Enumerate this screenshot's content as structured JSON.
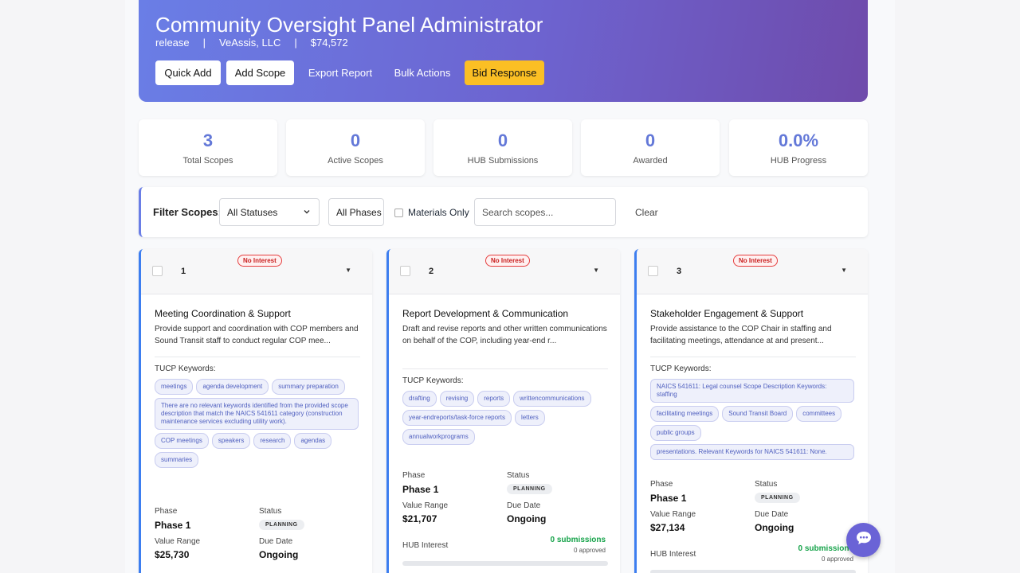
{
  "header": {
    "title": "Community Oversight Panel Administrator",
    "meta": [
      "release",
      "VeAssis, LLC",
      "$74,572"
    ],
    "separator": "|",
    "buttons": {
      "quick_add": "Quick Add",
      "add_scope": "Add Scope",
      "export_report": "Export Report",
      "bulk_actions": "Bulk Actions",
      "bid_response": "Bid Response"
    }
  },
  "stats": [
    {
      "value": "3",
      "label": "Total Scopes"
    },
    {
      "value": "0",
      "label": "Active Scopes"
    },
    {
      "value": "0",
      "label": "HUB Submissions"
    },
    {
      "value": "0",
      "label": "Awarded"
    },
    {
      "value": "0.0%",
      "label": "HUB Progress"
    }
  ],
  "filter": {
    "label": "Filter Scopes:",
    "status_select": "All Statuses",
    "phase_select": "All Phases",
    "materials_only": "Materials Only",
    "search_placeholder": "Search scopes...",
    "clear": "Clear"
  },
  "labels": {
    "tucp_keywords": "TUCP Keywords:",
    "phase": "Phase",
    "status": "Status",
    "value_range": "Value Range",
    "due_date": "Due Date",
    "hub_interest": "HUB Interest",
    "no_interest": "No Interest"
  },
  "cards": [
    {
      "number": "1",
      "title": "Meeting Coordination & Support",
      "description": "Provide support and coordination with COP members and Sound Transit staff to conduct regular COP mee...",
      "keywords": [
        "meetings",
        "agenda development",
        "summary preparation",
        "There are no relevant keywords identified from the provided scope description that match the NAICS 541611 category (construction maintenance services excluding utility work).",
        "COP meetings",
        "speakers",
        "research",
        "agendas",
        "summaries"
      ],
      "phase": "Phase 1",
      "status": "PLANNING",
      "value_range": "$25,730",
      "due_date": "Ongoing",
      "submissions": "",
      "approved": ""
    },
    {
      "number": "2",
      "title": "Report Development & Communication",
      "description": "Draft and revise reports and other written communications on behalf of the COP, including year-end r...",
      "keywords": [
        "drafting",
        "revising",
        "reports",
        "writtencommunications",
        "year-endreports/task-force reports",
        "letters",
        "annualworkprograms"
      ],
      "phase": "Phase 1",
      "status": "PLANNING",
      "value_range": "$21,707",
      "due_date": "Ongoing",
      "submissions": "0 submissions",
      "approved": "0 approved"
    },
    {
      "number": "3",
      "title": "Stakeholder Engagement & Support",
      "description": "Provide assistance to the COP Chair in staffing and facilitating meetings, attendance at and present...",
      "keywords": [
        "NAICS 541611: Legal counsel Scope Description Keywords: staffing",
        "facilitating meetings",
        "Sound Transit Board",
        "committees",
        "public groups",
        "presentations. Relevant Keywords for NAICS 541611: None."
      ],
      "phase": "Phase 1",
      "status": "PLANNING",
      "value_range": "$27,134",
      "due_date": "Ongoing",
      "submissions": "0 submissions",
      "approved": "0 approved"
    }
  ]
}
